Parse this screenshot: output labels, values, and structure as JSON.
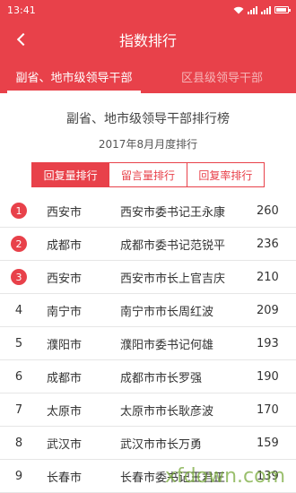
{
  "status_bar": {
    "time": "13:41"
  },
  "header": {
    "title": "指数排行"
  },
  "tabs": [
    {
      "label": "副省、地市级领导干部",
      "active": true
    },
    {
      "label": "区县级领导干部",
      "active": false
    }
  ],
  "content": {
    "heading": "副省、地市级领导干部排行榜",
    "subheading": "2017年8月月度排行"
  },
  "segments": [
    {
      "label": "回复量排行",
      "active": true
    },
    {
      "label": "留言量排行",
      "active": false
    },
    {
      "label": "回复率排行",
      "active": false
    }
  ],
  "rows": [
    {
      "rank": "1",
      "city": "西安市",
      "official": "西安市委书记王永康",
      "count": "260",
      "highlight": true
    },
    {
      "rank": "2",
      "city": "成都市",
      "official": "成都市委书记范锐平",
      "count": "236",
      "highlight": true
    },
    {
      "rank": "3",
      "city": "西安市",
      "official": "西安市市长上官吉庆",
      "count": "210",
      "highlight": true
    },
    {
      "rank": "4",
      "city": "南宁市",
      "official": "南宁市市长周红波",
      "count": "209",
      "highlight": false
    },
    {
      "rank": "5",
      "city": "濮阳市",
      "official": "濮阳市委书记何雄",
      "count": "193",
      "highlight": false
    },
    {
      "rank": "6",
      "city": "成都市",
      "official": "成都市市长罗强",
      "count": "190",
      "highlight": false
    },
    {
      "rank": "7",
      "city": "太原市",
      "official": "太原市市长耿彦波",
      "count": "170",
      "highlight": false
    },
    {
      "rank": "8",
      "city": "武汉市",
      "official": "武汉市市长万勇",
      "count": "159",
      "highlight": false
    },
    {
      "rank": "9",
      "city": "长春市",
      "official": "长春市委书记王君正",
      "count": "139",
      "highlight": false
    }
  ],
  "watermark": "xfdown.com",
  "colors": {
    "accent": "#e8414a"
  }
}
